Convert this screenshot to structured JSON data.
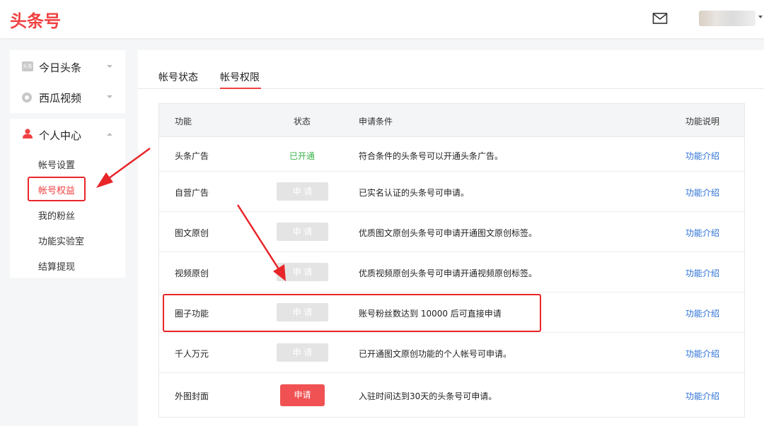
{
  "header": {
    "logo_text": "头条号",
    "mail_icon": "mail-icon",
    "avatar_icon": "user-avatar"
  },
  "sidebar": {
    "groups": [
      {
        "label": "今日头条",
        "icon": "toutiao-logo-icon",
        "icon_text": "头条"
      },
      {
        "label": "西瓜视频",
        "icon": "xigua-logo-icon"
      },
      {
        "label": "个人中心",
        "icon": "user-icon"
      }
    ],
    "sub_items": [
      {
        "label": "帐号设置"
      },
      {
        "label": "帐号权益",
        "active": true
      },
      {
        "label": "我的粉丝"
      },
      {
        "label": "功能实验室"
      },
      {
        "label": "结算提现"
      }
    ]
  },
  "tabs": [
    {
      "label": "帐号状态"
    },
    {
      "label": "帐号权限",
      "active": true
    }
  ],
  "table": {
    "headers": {
      "feature": "功能",
      "status": "状态",
      "condition": "申请条件",
      "description": "功能说明"
    },
    "rows": [
      {
        "feature": "头条广告",
        "status": "已开通",
        "condition": "符合条件的头条号可以开通头条广告。",
        "link": "功能介绍"
      },
      {
        "feature": "自营广告",
        "status": "申 请",
        "condition": "已实名认证的头条号可申请。",
        "link": "功能介绍"
      },
      {
        "feature": "图文原创",
        "status": "申 请",
        "condition": "优质图文原创头条号可申请开通图文原创标签。",
        "link": "功能介绍"
      },
      {
        "feature": "视频原创",
        "status": "申 请",
        "condition": "优质视频原创头条号可申请开通视频原创标签。",
        "link": "功能介绍"
      },
      {
        "feature": "圈子功能",
        "status": "申 请",
        "condition": "账号粉丝数达到 10000 后可直接申请",
        "link": "功能介绍"
      },
      {
        "feature": "千人万元",
        "status": "申 请",
        "condition": "已开通图文原创功能的个人帐号可申请。",
        "link": "功能介绍"
      },
      {
        "feature": "外图封面",
        "status": "申请",
        "condition": "入驻时间达到30天的头条号可申请。",
        "link": "功能介绍"
      }
    ]
  },
  "colors": {
    "brand": "#f04142",
    "opened_green": "#3bb44a",
    "link_blue": "#2a6fd6",
    "disabled_gray": "#e4e4e4",
    "annotation_red": "#e8262a"
  }
}
